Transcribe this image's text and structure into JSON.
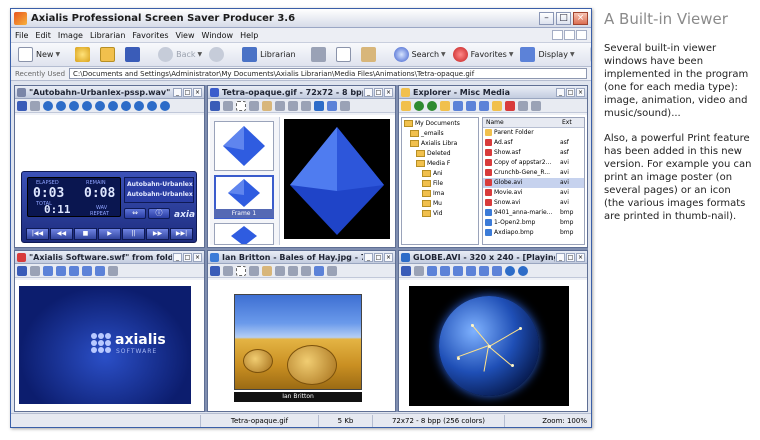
{
  "window": {
    "title": "Axialis Professional Screen Saver Producer 3.6"
  },
  "menu": [
    "File",
    "Edit",
    "Image",
    "Librarian",
    "Favorites",
    "View",
    "Window",
    "Help"
  ],
  "toolbar": {
    "new_label": "New",
    "back_label": "Back",
    "librarian_label": "Librarian",
    "search_label": "Search",
    "favorites_label": "Favorites",
    "display_label": "Display"
  },
  "pathbar": {
    "label": "Recently Used",
    "path": "C:\\Documents and Settings\\Administrator\\My Documents\\Axialis Librarian\\Media Files\\Animations\\Tetra-opaque.gif"
  },
  "panes": {
    "audio": {
      "title": "\"Autobahn-Urbanlex-pssp.wav\" fr",
      "elapsed_label": "ELAPSED",
      "remain_label": "REMAIN",
      "total_label": "TOTAL",
      "elapsed": "0:03",
      "remain": "0:08",
      "total": "0:11",
      "wav_label": "WAV",
      "repeat_label": "REPEAT",
      "track1": "Autobahn-Urbanlex-p",
      "track2": "Autobahn-Urbanlex-pss",
      "brand": "axia"
    },
    "gif": {
      "title": "Tetra-opaque.gif - 72x72 - 8 bpp (",
      "frame_label": "Frame 1"
    },
    "explorer": {
      "title": "Explorer - Misc Media",
      "tree": [
        "My Documents",
        "_emails",
        "Axialis Libra",
        "Deleted",
        "Media F",
        "Ani",
        "File",
        "Ima",
        "Mu",
        "Vid"
      ],
      "columns": [
        "Name",
        "Ext"
      ],
      "files": [
        {
          "name": "Parent Folder",
          "ext": "",
          "color": "#f1c04d"
        },
        {
          "name": "Ad.asf",
          "ext": "asf",
          "color": "#d83b3b"
        },
        {
          "name": "Show.asf",
          "ext": "asf",
          "color": "#d83b3b"
        },
        {
          "name": "Copy of appstar2...",
          "ext": "avi",
          "color": "#d83b3b"
        },
        {
          "name": "Crunchb-Gene_R...",
          "ext": "avi",
          "color": "#d83b3b"
        },
        {
          "name": "Globe.avi",
          "ext": "avi",
          "color": "#d83b3b"
        },
        {
          "name": "Movie.avi",
          "ext": "avi",
          "color": "#d83b3b"
        },
        {
          "name": "Snow.avi",
          "ext": "avi",
          "color": "#d83b3b"
        },
        {
          "name": "9401_anna-marie...",
          "ext": "bmp",
          "color": "#3b7bd8"
        },
        {
          "name": "1-Open2.bmp",
          "ext": "bmp",
          "color": "#3b7bd8"
        },
        {
          "name": "Axdiapo.bmp",
          "ext": "bmp",
          "color": "#3b7bd8"
        }
      ]
    },
    "swf": {
      "title": "\"Axialis Software.swf\" from folder",
      "logo_text": "axialis",
      "logo_sub": "SOFTWARE"
    },
    "jpg": {
      "title": "Ian Britton - Bales of Hay.jpg - 71",
      "caption": "Ian Britton"
    },
    "avi": {
      "title": "GLOBE.AVI - 320 x 240 - [Playing]"
    }
  },
  "status": {
    "file": "Tetra-opaque.gif",
    "size": "5 Kb",
    "info": "72x72 - 8 bpp (256 colors)",
    "zoom": "Zoom: 100%"
  },
  "side": {
    "heading": "A Built-in Viewer",
    "para1": "Several built-in viewer windows have been implemented in the program (one for each media type): image, animation, video and music/sound)...",
    "para2": "Also, a powerful Print feature has been added in this new version. For example you can print an image poster (on several pages) or an icon (the various images formats are printed in thumb-nail)."
  },
  "colors": {
    "accent": "#3b5ccc",
    "workspace": "#7f8eb0",
    "player": "#2a3da3"
  }
}
